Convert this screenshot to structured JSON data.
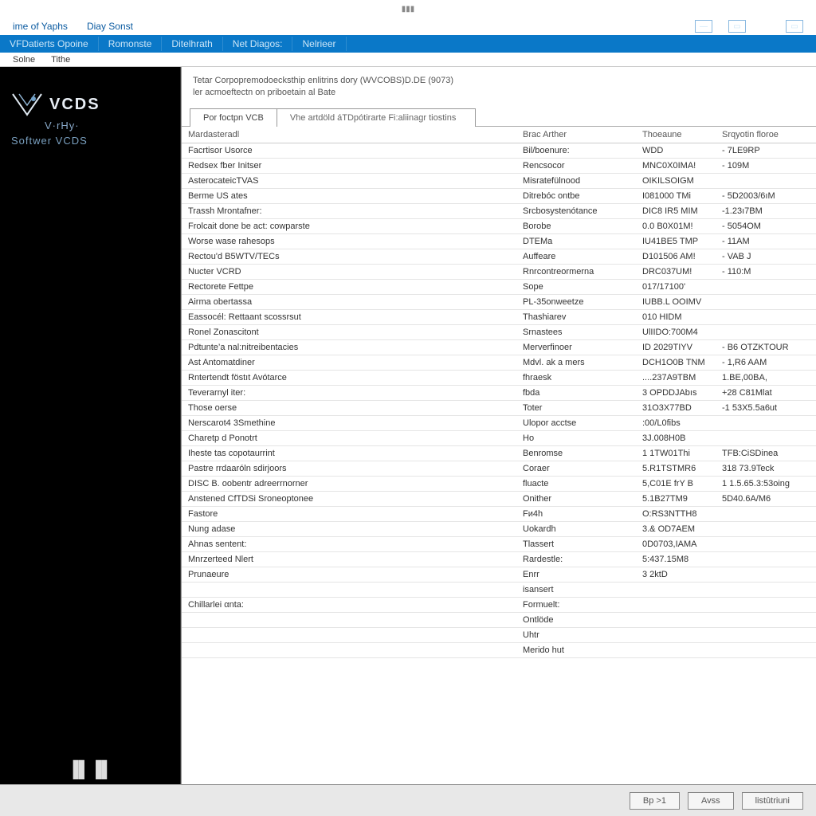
{
  "titlebar": {
    "center": "▮▮▮"
  },
  "menubar": {
    "items": [
      "ime of Yaphs",
      "Diay Sonst"
    ]
  },
  "toolbar": {
    "items": [
      "VFDatierts Opoine",
      "Romonste",
      "Ditelhrath",
      "Net Diagos:",
      "Nelrieer"
    ]
  },
  "subbar": {
    "items": [
      "Solne",
      "Tithe"
    ]
  },
  "sidebar": {
    "brand_main": "VCDS",
    "brand_sub": "V·rHy·",
    "brand_soft": "Softwer  VCDS"
  },
  "content": {
    "desc1": "Tetar Corpopremodoecksthip enlitrins dory (WVCOBS)D.DE (9073)",
    "desc2": "ler acmoeftectn on priboetain al Bate",
    "tab1": "Por foctpn VCB",
    "tab2": "Vhe artdöld áTDpótirarte Fi:aliinagr tiostins",
    "headers": {
      "c1": "Mardasteradl",
      "c2": "Brac Arther",
      "c3": "Thoeaune",
      "c4": "Srqyotin floroe"
    },
    "rows": [
      {
        "c1": "Facrtisor Usorce",
        "c2": "Bil/boenure:",
        "c3": "WDD",
        "c4": "- 7LE9RP"
      },
      {
        "c1": "Redsex fber Initser",
        "c2": "Rencsocor",
        "c3": "MNC0X0IMA!",
        "c4": "- 109M"
      },
      {
        "c1": "AsterocateicTVAS",
        "c2": "Misratefülnood",
        "c3": "OIKILSOIGM",
        "c4": ""
      },
      {
        "c1": "Berme US ates",
        "c2": "Ditrebóc ontbe",
        "c3": "I081000 TMi",
        "c4": "- 5D2003/6ıM"
      },
      {
        "c1": "Trassh Mrontafner:",
        "c2": "Srcbosystenótance",
        "c3": "DIC8 IR5 MIM",
        "c4": "-1.23ı7BM"
      },
      {
        "c1": "Frolcait done be act: cowparste",
        "c2": "Borobe",
        "c3": "0.0 B0X01M!",
        "c4": "- 5054OM"
      },
      {
        "c1": "Worse wase rahesops",
        "c2": "DTEMa",
        "c3": "IU41BE5 TMP",
        "c4": "- 11AM"
      },
      {
        "c1": "Rectou'd B5WTV/TECs",
        "c2": "Auffeare",
        "c3": "D101506 AM!",
        "c4": "- VAB J"
      },
      {
        "c1": "Nucter VCRD",
        "c2": "Rnrcontreormerna",
        "c3": "DRC037UM!",
        "c4": "- 110:M"
      },
      {
        "c1": "Rectorete Fettpe",
        "c2": "Sope",
        "c3": "017/17100'",
        "c4": ""
      },
      {
        "c1": "Airma obertassa",
        "c2": "PL-35onweetze",
        "c3": "IUBB.L OOIMV",
        "c4": ""
      },
      {
        "c1": "Eassocél: Rettaant scossrsut",
        "c2": "Thashiarev",
        "c3": "010 HIDM",
        "c4": ""
      },
      {
        "c1": "Ronel Zonascitont",
        "c2": "Srnastees",
        "c3": "UlIIDO:700M4",
        "c4": ""
      },
      {
        "c1": "Pdtunte’a nal:nitreibentacies",
        "c2": "Merverfinoer",
        "c3": "ID 2029TIYV",
        "c4": "- B6 OTZKTOUR"
      },
      {
        "c1": "Ast Antomatdiner",
        "c2": "Mdvl. ak a mers",
        "c3": "DCH1O0B TNM",
        "c4": "- 1,R6 AAM"
      },
      {
        "c1": "Rntertendt föstıt Avótarce",
        "c2": "fhraesk",
        "c3": "....237A9TBM",
        "c4": "1.BE,00BA,"
      },
      {
        "c1": "Teverarnyl iter:",
        "c2": "fbda",
        "c3": "3 OPDDJAbıs",
        "c4": "+28 C81Mlat"
      },
      {
        "c1": "Those oerse",
        "c2": "Toter",
        "c3": "31O3X77BD",
        "c4": "-1 53X5.5a6ut"
      },
      {
        "c1": "Nerscarot4 3Smethine",
        "c2": "Ulopor acctse",
        "c3": ":00/L0fibs",
        "c4": ""
      },
      {
        "c1": "Charetp d Ponotrt",
        "c2": "Ho",
        "c3": "3J.008H0B",
        "c4": ""
      },
      {
        "c1": "Iheste tas copotaurrint",
        "c2": "Benromse",
        "c3": "1 1TW01Thi",
        "c4": "TFB:CiSDinea"
      },
      {
        "c1": "Pastre rrdaaróln sdirjoors",
        "c2": "Coraer",
        "c3": "5.R1TSTMR6",
        "c4": "318 73.9Teck"
      },
      {
        "c1": "DISC B. oobentr adreerrnorner",
        "c2": "fluacte",
        "c3": "5,C01E frY B",
        "c4": "1 1.5.65.3:53oing"
      },
      {
        "c1": "Anstened CfTDSi Sroneoptonee",
        "c2": "Onither",
        "c3": "5.1B27TM9",
        "c4": "5D40.6A/M6"
      },
      {
        "c1": "Fastore",
        "c2": "Fи4h",
        "c3": "O:RS3NTTH8",
        "c4": ""
      },
      {
        "c1": "Nung adase",
        "c2": "Uokardh",
        "c3": "3.& OD7AEM",
        "c4": ""
      },
      {
        "c1": "Ahnas sentent:",
        "c2": "Tlassert",
        "c3": "0D0703,IAMA",
        "c4": ""
      },
      {
        "c1": "Mnrzerteed Nlert",
        "c2": "Rardestle:",
        "c3": "5:437.15M8",
        "c4": ""
      },
      {
        "c1": "Prunaeure",
        "c2": "Enrr",
        "c3": "3 2ktD",
        "c4": ""
      },
      {
        "c1": "",
        "c2": "isansert",
        "c3": "",
        "c4": ""
      },
      {
        "c1": "Chillarlei αnta:",
        "c2": "Formuelt:",
        "c3": "",
        "c4": ""
      },
      {
        "c1": "",
        "c2": "Ontlöde",
        "c3": "",
        "c4": ""
      },
      {
        "c1": "",
        "c2": "Uhtr",
        "c3": "",
        "c4": ""
      },
      {
        "c1": "",
        "c2": "Merido hut",
        "c3": "",
        "c4": ""
      }
    ]
  },
  "footer": {
    "b1": "Bp >1",
    "b2": "Avss",
    "b3": "listûtriuni"
  }
}
